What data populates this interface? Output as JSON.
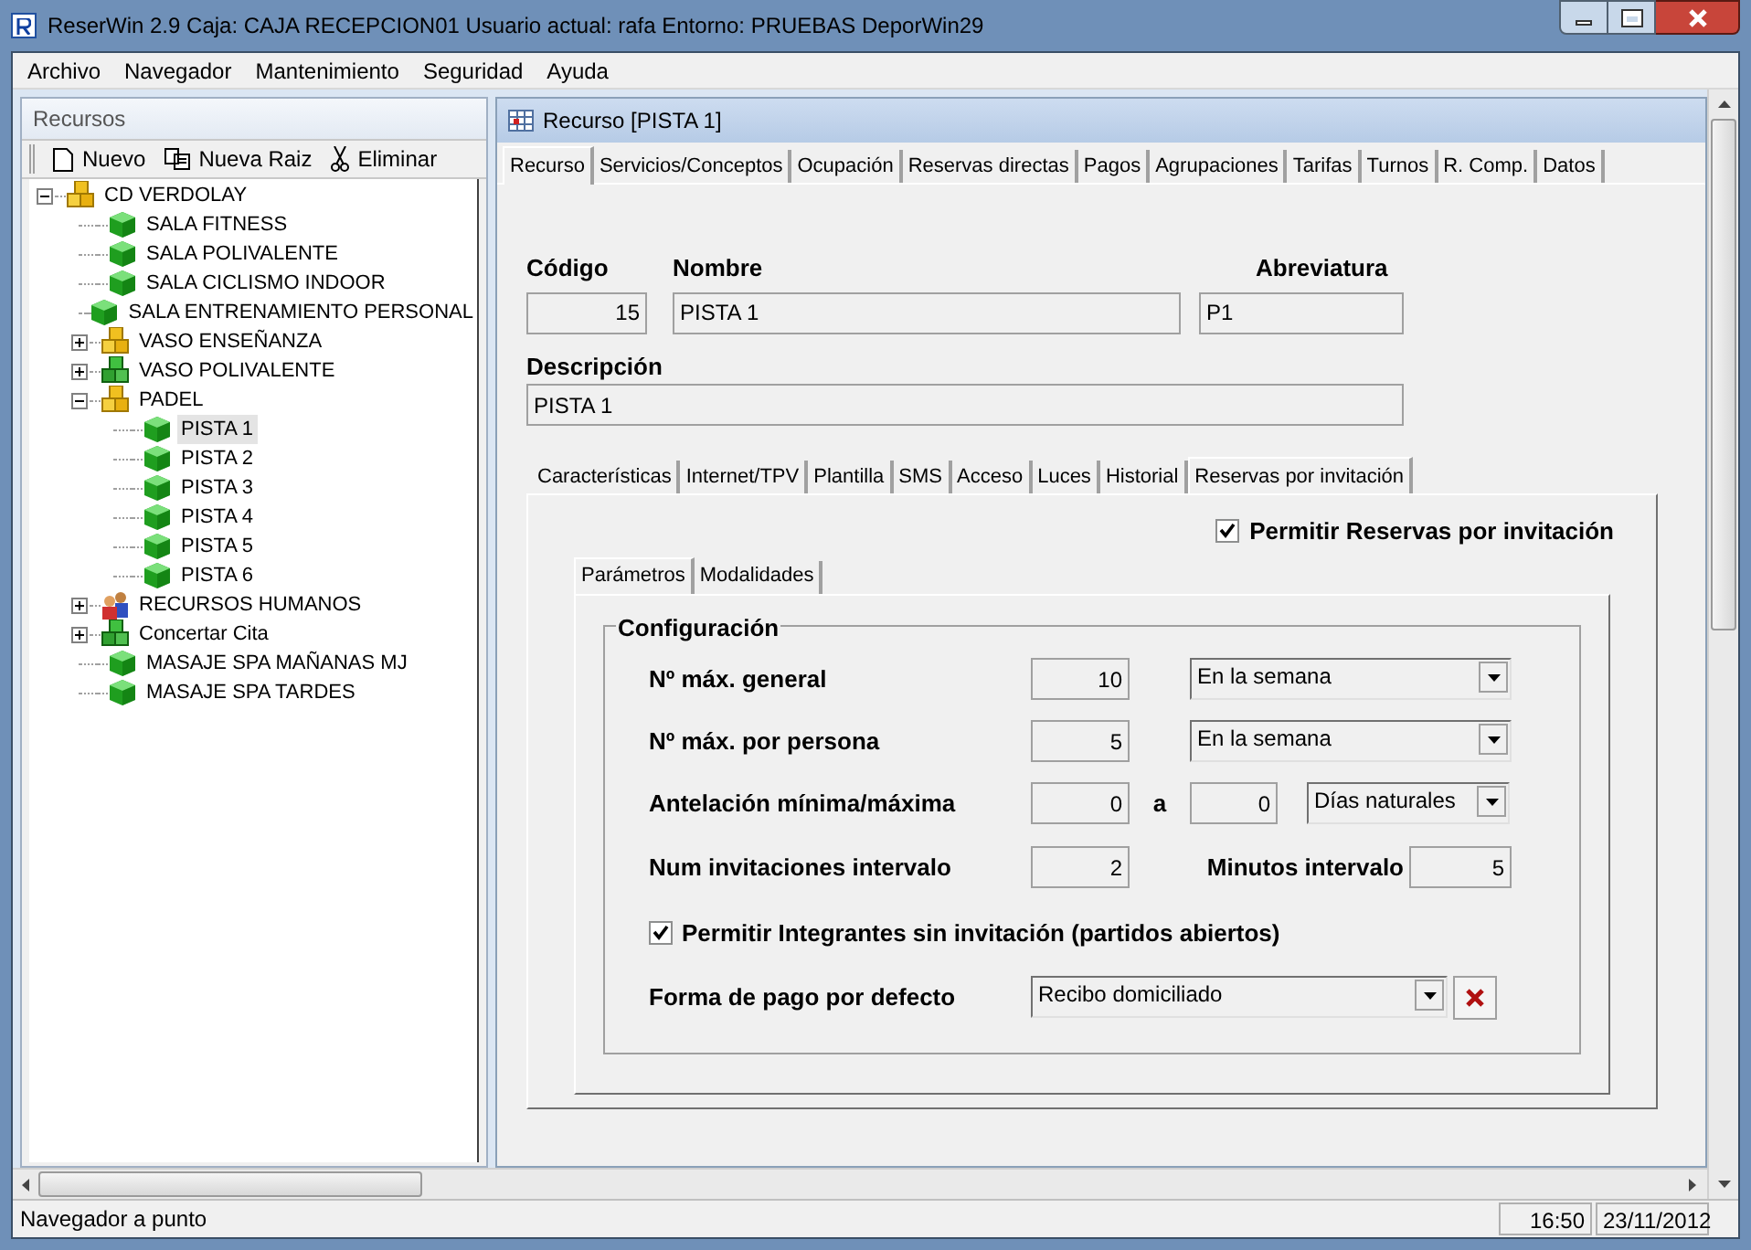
{
  "window": {
    "title": "ReserWin 2.9  Caja: CAJA RECEPCION01  Usuario actual: rafa  Entorno: PRUEBAS DeporWin29"
  },
  "menu": [
    "Archivo",
    "Navegador",
    "Mantenimiento",
    "Seguridad",
    "Ayuda"
  ],
  "navigator": {
    "title": "Recursos",
    "toolbar": [
      {
        "label": "Nuevo",
        "kind": "new"
      },
      {
        "label": "Nueva Raiz",
        "kind": "copy"
      },
      {
        "label": "Eliminar",
        "kind": "cut"
      }
    ],
    "tree": [
      {
        "label": "CD VERDOLAY",
        "kind": "group-yellow",
        "expanded": true,
        "selected": false,
        "children": [
          {
            "label": "SALA FITNESS",
            "kind": "cube",
            "selected": false
          },
          {
            "label": "SALA POLIVALENTE",
            "kind": "cube",
            "selected": false
          },
          {
            "label": "SALA CICLISMO INDOOR",
            "kind": "cube",
            "selected": false
          },
          {
            "label": "SALA ENTRENAMIENTO PERSONAL",
            "kind": "cube",
            "selected": false
          },
          {
            "label": "VASO ENSEÑANZA",
            "kind": "group-yellow",
            "expanded": false,
            "selected": false
          },
          {
            "label": "VASO POLIVALENTE",
            "kind": "group-green",
            "expanded": false,
            "selected": false
          },
          {
            "label": "PADEL",
            "kind": "group-yellow",
            "expanded": true,
            "selected": false,
            "children": [
              {
                "label": "PISTA 1",
                "kind": "cube",
                "selected": true
              },
              {
                "label": "PISTA 2",
                "kind": "cube",
                "selected": false
              },
              {
                "label": "PISTA 3",
                "kind": "cube",
                "selected": false
              },
              {
                "label": "PISTA 4",
                "kind": "cube",
                "selected": false
              },
              {
                "label": "PISTA 5",
                "kind": "cube",
                "selected": false
              },
              {
                "label": "PISTA 6",
                "kind": "cube",
                "selected": false
              }
            ]
          },
          {
            "label": "RECURSOS HUMANOS",
            "kind": "people",
            "expanded": false,
            "selected": false
          },
          {
            "label": "Concertar Cita",
            "kind": "group-green",
            "expanded": false,
            "selected": false
          },
          {
            "label": "MASAJE SPA MAÑANAS MJ",
            "kind": "cube",
            "selected": false
          },
          {
            "label": "MASAJE SPA TARDES",
            "kind": "cube",
            "selected": false
          }
        ]
      }
    ]
  },
  "document": {
    "title": "Recurso [PISTA 1]",
    "tabs": [
      {
        "label": "Recurso",
        "selected": true
      },
      {
        "label": "Servicios/Conceptos",
        "selected": false
      },
      {
        "label": "Ocupación",
        "selected": false
      },
      {
        "label": "Reservas directas",
        "selected": false
      },
      {
        "label": "Pagos",
        "selected": false
      },
      {
        "label": "Agrupaciones",
        "selected": false
      },
      {
        "label": "Tarifas",
        "selected": false
      },
      {
        "label": "Turnos",
        "selected": false
      },
      {
        "label": "R. Comp.",
        "selected": false
      },
      {
        "label": "Datos",
        "selected": false
      }
    ],
    "fields": [
      {
        "label": "Código",
        "value": "15"
      },
      {
        "label": "Nombre",
        "value": "PISTA 1"
      },
      {
        "label": "Abreviatura",
        "value": "P1"
      }
    ],
    "description": {
      "label": "Descripción",
      "value": "PISTA 1"
    },
    "subtabs": [
      {
        "label": "Características",
        "selected": false
      },
      {
        "label": "Internet/TPV",
        "selected": false
      },
      {
        "label": "Plantilla",
        "selected": false
      },
      {
        "label": "SMS",
        "selected": false
      },
      {
        "label": "Acceso",
        "selected": false
      },
      {
        "label": "Luces",
        "selected": false
      },
      {
        "label": "Historial",
        "selected": false
      },
      {
        "label": "Reservas por invitación",
        "selected": true
      }
    ],
    "allow_invitations": {
      "label": "Permitir Reservas por invitación",
      "checked": true
    },
    "inner_tabs": [
      {
        "label": "Parámetros",
        "selected": true
      },
      {
        "label": "Modalidades",
        "selected": false
      }
    ],
    "config": {
      "title": "Configuración",
      "rows": [
        {
          "kind": "number-combo",
          "label": "Nº máx. general",
          "value": "10",
          "combo": "En la semana"
        },
        {
          "kind": "number-combo",
          "label": "Nº máx. por persona",
          "value": "5",
          "combo": "En la semana"
        },
        {
          "kind": "range",
          "label": "Antelación mínima/máxima",
          "min": "0",
          "separator": "a",
          "max": "0",
          "combo": "Días naturales"
        },
        {
          "kind": "pair",
          "label": "Num invitaciones intervalo",
          "value": "2",
          "label2": "Minutos intervalo",
          "value2": "5"
        },
        {
          "kind": "checkbox",
          "label": "Permitir Integrantes sin invitación (partidos abiertos)",
          "checked": true
        },
        {
          "kind": "combo-clear",
          "label": "Forma de pago por defecto",
          "combo": "Recibo domiciliado"
        }
      ]
    }
  },
  "status_bar": {
    "message": "Navegador a punto",
    "time": "16:50",
    "date": "23/11/2012"
  }
}
